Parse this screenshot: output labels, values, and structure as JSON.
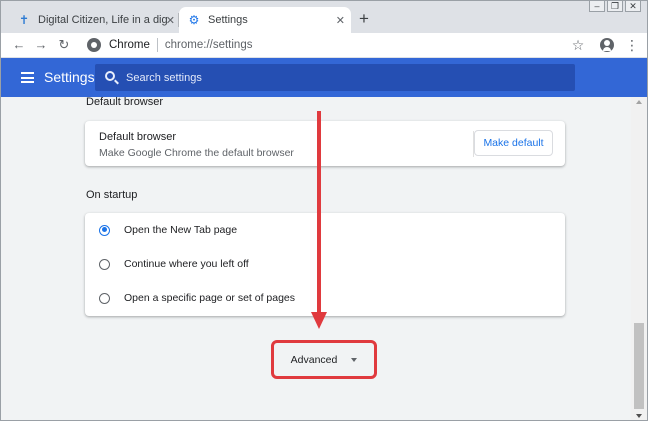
{
  "browser": {
    "tabs": [
      {
        "title": "Digital Citizen, Life in a digital w",
        "icon": "digital-citizen-icon",
        "active": false
      },
      {
        "title": "Settings",
        "icon": "gear-icon",
        "active": true
      }
    ],
    "new_tab_icon": "plus-icon",
    "window_controls": [
      "minimize-icon",
      "restore-icon",
      "close-icon"
    ],
    "omnibox": {
      "scheme_label": "Chrome",
      "url": "chrome://settings"
    },
    "toolbar_icons": [
      "back-icon",
      "forward-icon",
      "reload-icon",
      "star-icon",
      "profile-icon",
      "menu-icon"
    ]
  },
  "header": {
    "title": "Settings",
    "search_placeholder": "Search settings"
  },
  "sections": {
    "default_browser": {
      "heading": "Default browser",
      "title": "Default browser",
      "subtitle": "Make Google Chrome the default browser",
      "button_label": "Make default"
    },
    "on_startup": {
      "heading": "On startup",
      "options": [
        {
          "label": "Open the New Tab page",
          "checked": true
        },
        {
          "label": "Continue where you left off",
          "checked": false
        },
        {
          "label": "Open a specific page or set of pages",
          "checked": false
        }
      ]
    }
  },
  "advanced": {
    "label": "Advanced"
  },
  "colors": {
    "header_blue": "#3367d6",
    "search_blue": "#254fb3",
    "accent_blue": "#1a73e8",
    "annotation_red": "#e03a3e",
    "background": "#f1f3f4"
  }
}
